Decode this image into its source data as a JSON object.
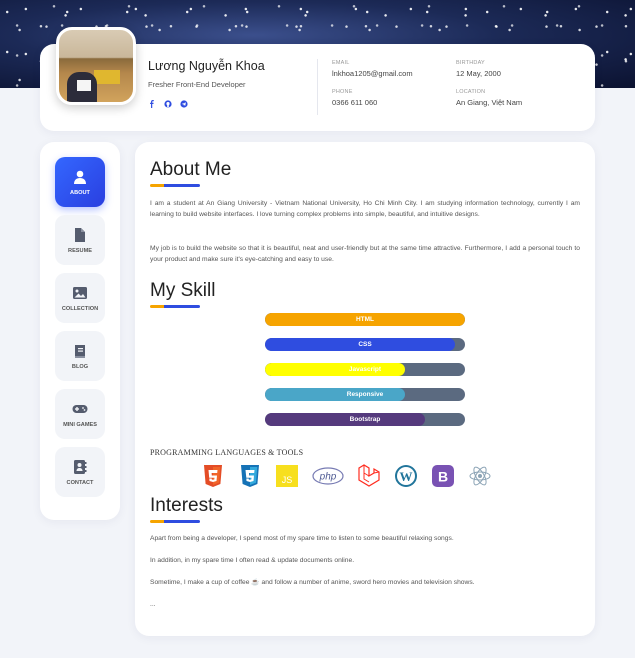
{
  "profile": {
    "name": "Lương Nguyễn Khoa",
    "role": "Fresher Front-End Developer",
    "socials": [
      "facebook-icon",
      "github-icon",
      "telegram-icon"
    ],
    "info": [
      {
        "key": "EMAIL",
        "value": "lnkhoa1205@gmail.com"
      },
      {
        "key": "BIRTHDAY",
        "value": "12 May, 2000"
      },
      {
        "key": "PHONE",
        "value": "0366 611 060"
      },
      {
        "key": "LOCATION",
        "value": "An Giang, Việt Nam"
      }
    ]
  },
  "nav": [
    {
      "label": "ABOUT",
      "icon": "user-icon",
      "active": true
    },
    {
      "label": "RESUME",
      "icon": "file-icon",
      "active": false
    },
    {
      "label": "COLLECTION",
      "icon": "image-icon",
      "active": false
    },
    {
      "label": "BLOG",
      "icon": "book-icon",
      "active": false
    },
    {
      "label": "MINI GAMES",
      "icon": "gamepad-icon",
      "active": false
    },
    {
      "label": "CONTACT",
      "icon": "contact-book-icon",
      "active": false
    }
  ],
  "about": {
    "title": "About Me",
    "p1": "I am a student at An Giang University - Vietnam National University, Ho Chi Minh City. I am studying information technology, currently I am learning to build website interfaces. I love turning complex problems into simple, beautiful, and intuitive designs.",
    "p2": "My job is to build the website so that it is beautiful, neat and user-friendly but at the same time attractive. Furthermore, I add a personal touch to your product and make sure it's eye-catching and easy to use."
  },
  "skills": {
    "title": "My Skill",
    "items": [
      {
        "name": "HTML",
        "level": 1.0,
        "color": "#f6a400"
      },
      {
        "name": "CSS",
        "level": 0.95,
        "color": "#2f4de0"
      },
      {
        "name": "Javascript",
        "level": 0.7,
        "color": "#ffff00"
      },
      {
        "name": "Responsive",
        "level": 0.7,
        "color": "#4aa6c8"
      },
      {
        "name": "Bootstrap",
        "level": 0.8,
        "color": "#553a7d"
      }
    ],
    "tools_title": "PROGRAMMING LANGUAGES & TOOLS",
    "tools": [
      "html5-icon",
      "css3-icon",
      "js-icon",
      "php-icon",
      "laravel-icon",
      "wordpress-icon",
      "bootstrap-icon",
      "react-icon"
    ]
  },
  "interests": {
    "title": "Interests",
    "p1": "Apart from being a developer, I spend most of my spare time to listen to some beautiful relaxing songs.",
    "p2": "In addition, in my spare time I often read & update documents online.",
    "p3": "Sometime, I make a cup of coffee ☕ and follow a number of anime, sword hero movies and television shows.",
    "p4": "..."
  }
}
